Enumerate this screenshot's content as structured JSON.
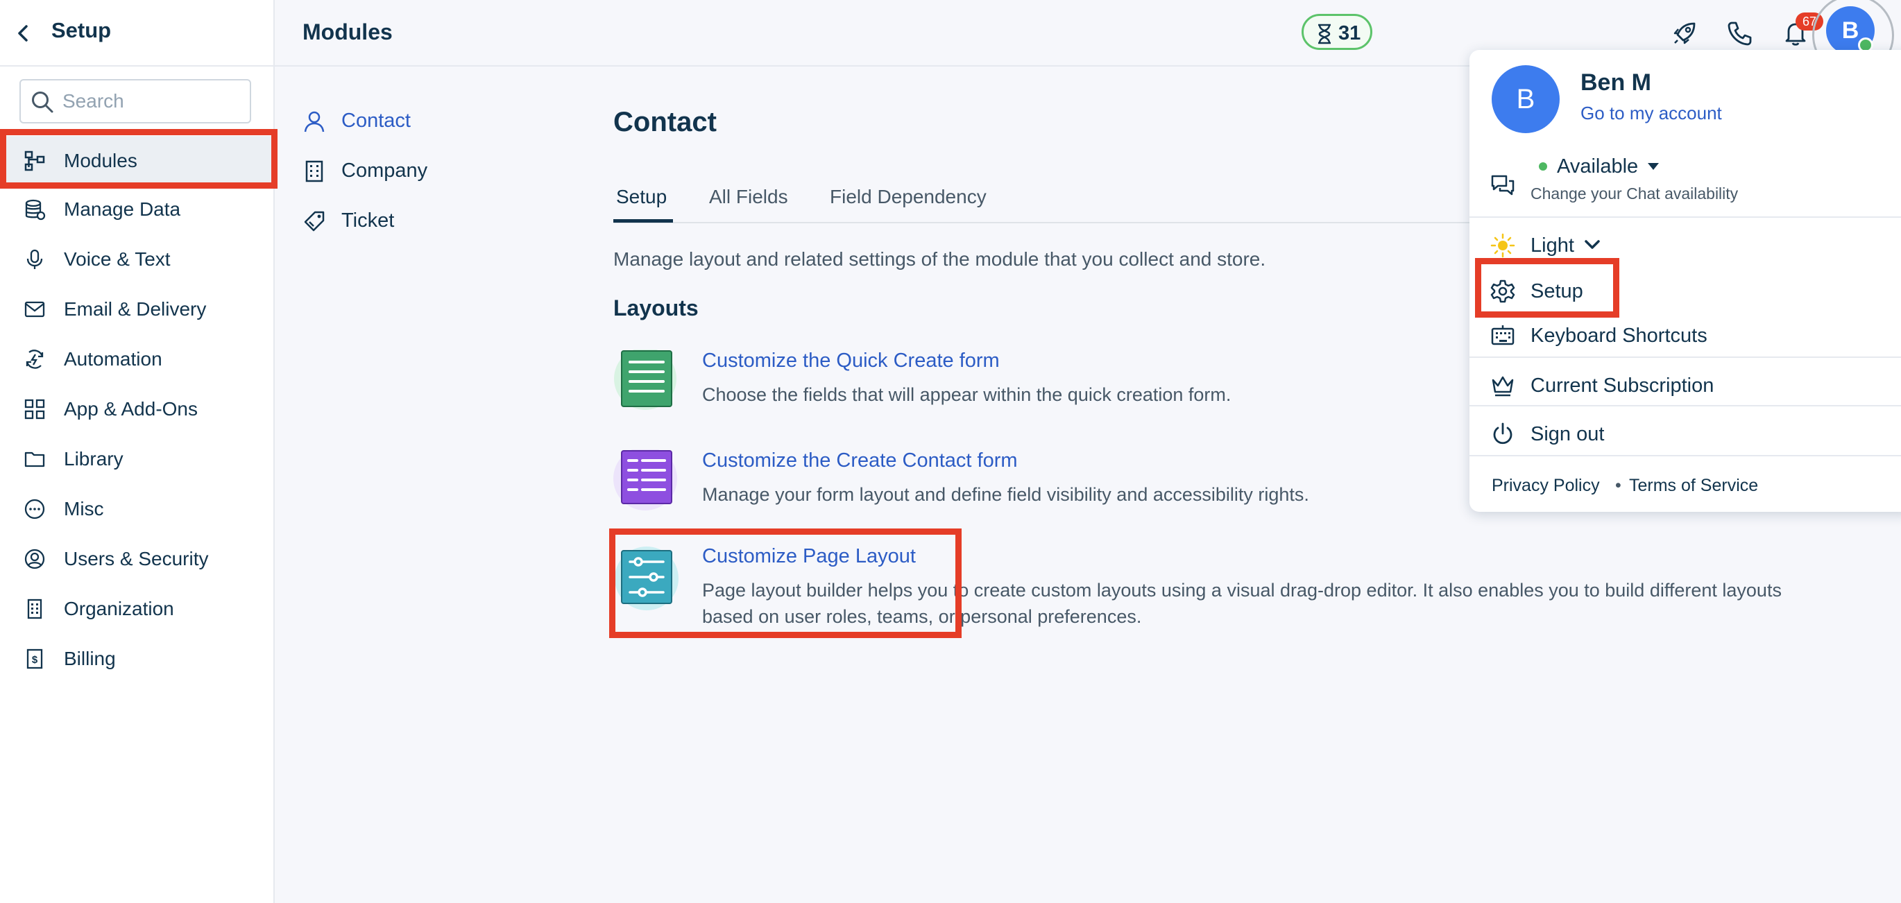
{
  "sidebar": {
    "title": "Setup",
    "search_placeholder": "Search",
    "items": [
      {
        "label": "Modules",
        "icon": "modules-icon"
      },
      {
        "label": "Manage Data",
        "icon": "database-icon"
      },
      {
        "label": "Voice & Text",
        "icon": "microphone-icon"
      },
      {
        "label": "Email & Delivery",
        "icon": "envelope-icon"
      },
      {
        "label": "Automation",
        "icon": "automation-icon"
      },
      {
        "label": "App & Add-Ons",
        "icon": "apps-grid-icon"
      },
      {
        "label": "Library",
        "icon": "folder-icon"
      },
      {
        "label": "Misc",
        "icon": "more-circle-icon"
      },
      {
        "label": "Users & Security",
        "icon": "user-circle-icon"
      },
      {
        "label": "Organization",
        "icon": "building-icon"
      },
      {
        "label": "Billing",
        "icon": "billing-icon"
      }
    ]
  },
  "topbar": {
    "title": "Modules",
    "trial_days": "31",
    "notification_count": "67",
    "avatar_initial": "B"
  },
  "subnav": {
    "items": [
      {
        "label": "Contact",
        "icon": "person-icon"
      },
      {
        "label": "Company",
        "icon": "building-icon"
      },
      {
        "label": "Ticket",
        "icon": "ticket-icon"
      }
    ]
  },
  "main": {
    "title": "Contact",
    "tabs": [
      "Setup",
      "All Fields",
      "Field Dependency"
    ],
    "description": "Manage layout and related settings of the module that you collect and store.",
    "layouts_heading": "Layouts",
    "layouts": [
      {
        "title": "Customize the Quick Create form",
        "desc": "Choose the fields that will appear within the quick creation form.",
        "icon": "quick-form-icon"
      },
      {
        "title": "Customize the Create Contact form",
        "desc": "Manage your form layout and define field visibility and accessibility rights.",
        "icon": "contact-form-icon"
      },
      {
        "title": "Customize Page Layout",
        "desc": "Page layout builder helps you to create custom layouts using a visual drag-drop editor. It also enables you to build different layouts based on user roles, teams, or personal preferences.",
        "icon": "sliders-icon"
      }
    ]
  },
  "dropdown": {
    "avatar_initial": "B",
    "name": "Ben M",
    "account_link": "Go to my account",
    "status": "Available",
    "status_hint": "Change your Chat availability",
    "theme": "Light",
    "setup": "Setup",
    "keyboard": "Keyboard Shortcuts",
    "subscription": "Current Subscription",
    "signout": "Sign out",
    "privacy": "Privacy Policy",
    "bullet": "•",
    "terms": "Terms of Service"
  },
  "colors": {
    "accent": "#2c5cc5",
    "highlight": "#e53d27",
    "text": "#12344d",
    "available": "#4eb862"
  }
}
